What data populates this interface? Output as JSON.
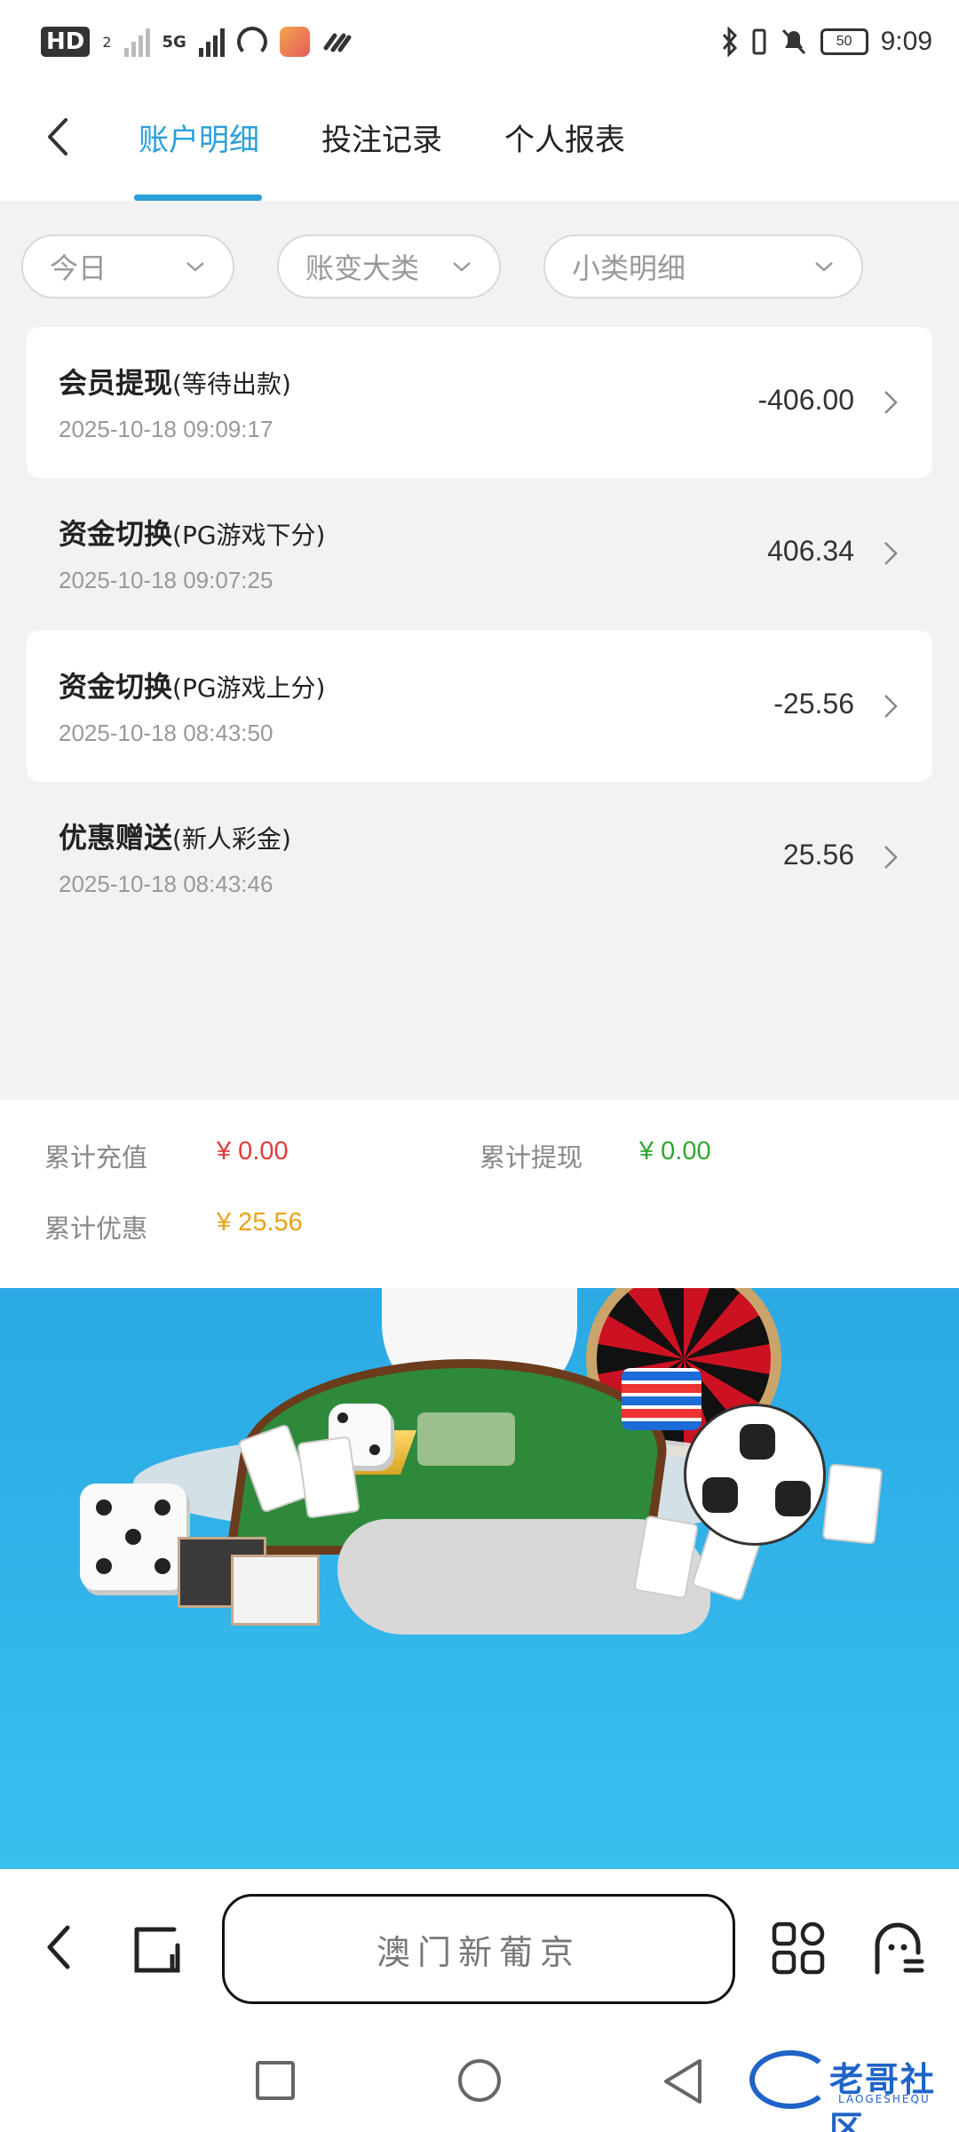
{
  "status_bar": {
    "hd": "HD",
    "hd_sub": "2",
    "net": "5G",
    "battery": "50",
    "time": "9:09"
  },
  "header": {
    "tabs": [
      {
        "label": "账户明细",
        "active": true
      },
      {
        "label": "投注记录",
        "active": false
      },
      {
        "label": "个人报表",
        "active": false
      }
    ]
  },
  "filters": {
    "date": "今日",
    "category": "账变大类",
    "subcategory": "小类明细"
  },
  "transactions": [
    {
      "title": "会员提现",
      "note": "(等待出款)",
      "time": "2025-10-18 09:09:17",
      "amount": "-406.00"
    },
    {
      "title": "资金切换",
      "note": "(PG游戏下分)",
      "time": "2025-10-18 09:07:25",
      "amount": "406.34"
    },
    {
      "title": "资金切换",
      "note": "(PG游戏上分)",
      "time": "2025-10-18 08:43:50",
      "amount": "-25.56"
    },
    {
      "title": "优惠赠送",
      "note": "(新人彩金)",
      "time": "2025-10-18 08:43:46",
      "amount": "25.56"
    }
  ],
  "summary": {
    "deposit_label": "累计充值",
    "deposit_value": "¥ 0.00",
    "withdraw_label": "累计提现",
    "withdraw_value": "¥ 0.00",
    "bonus_label": "累计优惠",
    "bonus_value": "¥ 25.56"
  },
  "browser": {
    "url_text": "澳门新葡京"
  },
  "watermark": {
    "text": "老哥社区",
    "sub": "LAOGESHEQU"
  },
  "colors": {
    "accent": "#2a9fd8",
    "deposit": "#e03b3b",
    "withdraw": "#2fa62f",
    "bonus": "#e8a317"
  }
}
